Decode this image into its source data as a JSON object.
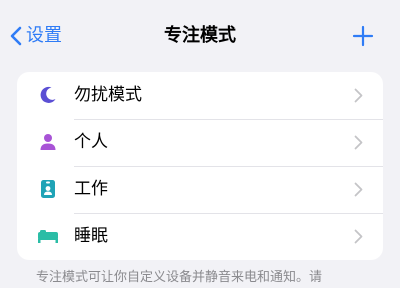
{
  "nav": {
    "back_label": "设置",
    "title": "专注模式",
    "add_icon": "plus-icon"
  },
  "colors": {
    "accent": "#2f7cf6",
    "moon": "#5b4fd4",
    "person": "#a853d6",
    "work": "#1fa3b6",
    "sleep": "#2bbda6",
    "chevron": "#c4c4c7"
  },
  "modes": [
    {
      "label": "勿扰模式",
      "icon": "moon-icon"
    },
    {
      "label": "个人",
      "icon": "person-icon"
    },
    {
      "label": "工作",
      "icon": "badge-icon"
    },
    {
      "label": "睡眠",
      "icon": "bed-icon"
    }
  ],
  "footnote": "专注模式可让你自定义设备并静音来电和通知。请"
}
